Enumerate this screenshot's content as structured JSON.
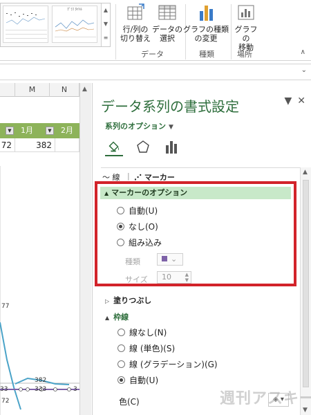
{
  "ribbon": {
    "thumbnails": [
      {
        "title": ""
      },
      {
        "title": "ｸﾞﾗﾌ ﾀｲﾄﾙ"
      }
    ],
    "buttons": [
      {
        "label_line1": "行/列の",
        "label_line2": "切り替え",
        "icon": "switch-row-column-icon"
      },
      {
        "label_line1": "データの",
        "label_line2": "選択",
        "icon": "select-data-icon"
      },
      {
        "label_line1": "グラフの種類",
        "label_line2": "の変更",
        "icon": "change-chart-type-icon"
      },
      {
        "label_line1": "グラフの",
        "label_line2": "移動",
        "icon": "move-chart-icon"
      }
    ],
    "groups": [
      "データ",
      "種類",
      "場所"
    ]
  },
  "sheet": {
    "columns": [
      "M",
      "N"
    ],
    "header_cells": [
      "1月",
      "2月"
    ],
    "values": [
      "72",
      "382"
    ],
    "data_labels": [
      "77",
      "382",
      "333",
      "33",
      "72",
      "3"
    ]
  },
  "pane": {
    "title": "データ系列の書式設定",
    "series_options": "系列のオプション",
    "tab_line": "線",
    "tab_marker": "マーカー",
    "marker_options": {
      "header": "マーカーのオプション",
      "radio_auto": "自動(U)",
      "radio_none": "なし(O)",
      "radio_builtin": "組み込み",
      "type_label": "種類",
      "size_label": "サイズ",
      "size_value": "10",
      "selected": "なし(O)",
      "swatch_color": "#7e62a8"
    },
    "fill_section": "塗りつぶし",
    "border_section": "枠線",
    "border_options": {
      "none": "線なし(N)",
      "solid": "線 (単色)(S)",
      "gradient": "線 (グラデーション)(G)",
      "auto": "自動(U)",
      "selected": "自動(U)"
    },
    "color_label": "色(C)"
  },
  "watermark": "週刊アスキー",
  "colors": {
    "accent_green": "#2e6e3c",
    "header_green": "#8db35a",
    "highlight_red": "#d2232a",
    "marker_header_bg": "#c8e9c9"
  }
}
